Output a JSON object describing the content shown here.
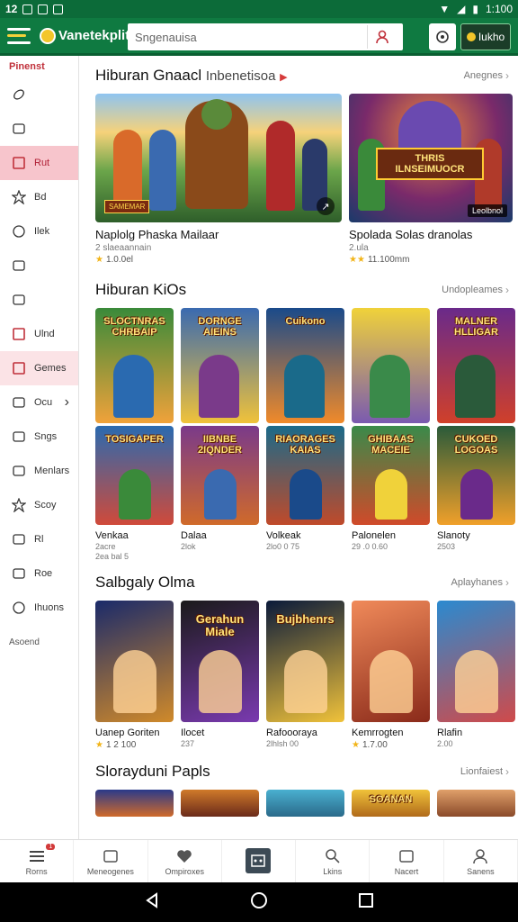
{
  "status": {
    "time_left": "12",
    "time_right": "1:100"
  },
  "topbar": {
    "logo_text": "Vanetekplit",
    "search_placeholder": "Sngenauisa",
    "mini_label": "Iukho"
  },
  "sidebar": {
    "heading": "Pinenst",
    "items": [
      {
        "label": "",
        "icon": "gamepad-icon"
      },
      {
        "label": "",
        "icon": "map-icon"
      },
      {
        "label": "Rut",
        "icon": "tag-icon",
        "active": true
      },
      {
        "label": "Bd",
        "icon": "puzzle-icon"
      },
      {
        "label": "Ilek",
        "icon": "chat-icon"
      },
      {
        "label": "",
        "icon": "grid-icon"
      },
      {
        "label": "",
        "icon": "bow-icon"
      },
      {
        "label": "Ulnd",
        "icon": "calendar-icon"
      },
      {
        "label": "Gemes",
        "icon": "calendar-red-icon",
        "active_light": true
      },
      {
        "label": "Ocu",
        "icon": "controller-icon",
        "chevron": true
      },
      {
        "label": "Sngs",
        "icon": "screen-icon"
      },
      {
        "label": "Menlars",
        "icon": "film-icon"
      },
      {
        "label": "Scoy",
        "icon": "star-icon"
      },
      {
        "label": "Rl",
        "icon": "tv-icon"
      },
      {
        "label": "Roe",
        "icon": "infinity-icon"
      },
      {
        "label": "Ihuons",
        "icon": "chat-bubble-icon"
      }
    ],
    "footer": "Asoend"
  },
  "sections": {
    "featured": {
      "title": "Hiburan Gnaacl",
      "subtitle": "Inbenetisoa",
      "link": "Anegnes",
      "cards": [
        {
          "name": "Naplolg Phaska Mailaar",
          "sub": "2 slaeaannain",
          "rating": "1.0.0el",
          "colors": [
            "#2a5e2a",
            "#7aa5d9",
            "#c8813a"
          ]
        },
        {
          "name": "Spolada Solas dranolas",
          "sub": "2.ula",
          "rating": "11.100mm",
          "badge": "Leolbnol",
          "banner": "THRIS ILNSEIMUOCR",
          "colors": [
            "#3a1b5e",
            "#d06a1a",
            "#1a6c8a"
          ]
        }
      ]
    },
    "kids": {
      "title": "Hiburan KiOs",
      "link": "Undopleames",
      "cards": [
        {
          "name": "Venkaa",
          "sub": "2acre",
          "sub2": "2ea bal 5",
          "top": "SLOCTNRAS CHRBAIP",
          "bottom": "TOSIGAPER"
        },
        {
          "name": "Dalaa",
          "sub": "2lok",
          "top": "DORNGE AIEINS",
          "bottom": "IIBNBE 2IQNDER"
        },
        {
          "name": "Volkeak",
          "sub": "2lo0 0 75",
          "top": "Cuikono",
          "bottom": "RIAORAGES KAIAS"
        },
        {
          "name": "Palonelen",
          "sub": "29 .0 0.60",
          "top": "",
          "bottom": "GHIBAAS MACEIE"
        },
        {
          "name": "Slanoty",
          "sub": "2503",
          "top": "MALNER HLLIGAR",
          "bottom": "CUKOED LOGOAS"
        }
      ]
    },
    "selected": {
      "title": "Salbgaly Olma",
      "link": "Aplayhanes",
      "cards": [
        {
          "name": "Uanep Goriten",
          "sub": "",
          "rating": "1 2 100"
        },
        {
          "name": "Ilocet",
          "sub": "237",
          "poster": "Gerahun Miale"
        },
        {
          "name": "Rafoooraya",
          "sub": "2lhlsh 00",
          "poster": "Bujbhenrs"
        },
        {
          "name": "Kemrrogten",
          "sub": "",
          "rating": "1.7.00"
        },
        {
          "name": "Rlafin",
          "sub": "2.00"
        }
      ]
    },
    "popular": {
      "title": "Slorayduni Papls",
      "link": "Lionfaiest",
      "poster": "SOANAN"
    }
  },
  "bottom_nav": [
    {
      "label": "Rorns",
      "icon": "list-icon",
      "badge": "1"
    },
    {
      "label": "Meneogenes",
      "icon": "horse-icon"
    },
    {
      "label": "Ompiroxes",
      "icon": "heart-icon"
    },
    {
      "label": "",
      "icon": "game-center-icon"
    },
    {
      "label": "Lkins",
      "icon": "search-icon"
    },
    {
      "label": "Nacert",
      "icon": "bell-icon"
    },
    {
      "label": "Sanens",
      "icon": "profile-icon"
    }
  ]
}
